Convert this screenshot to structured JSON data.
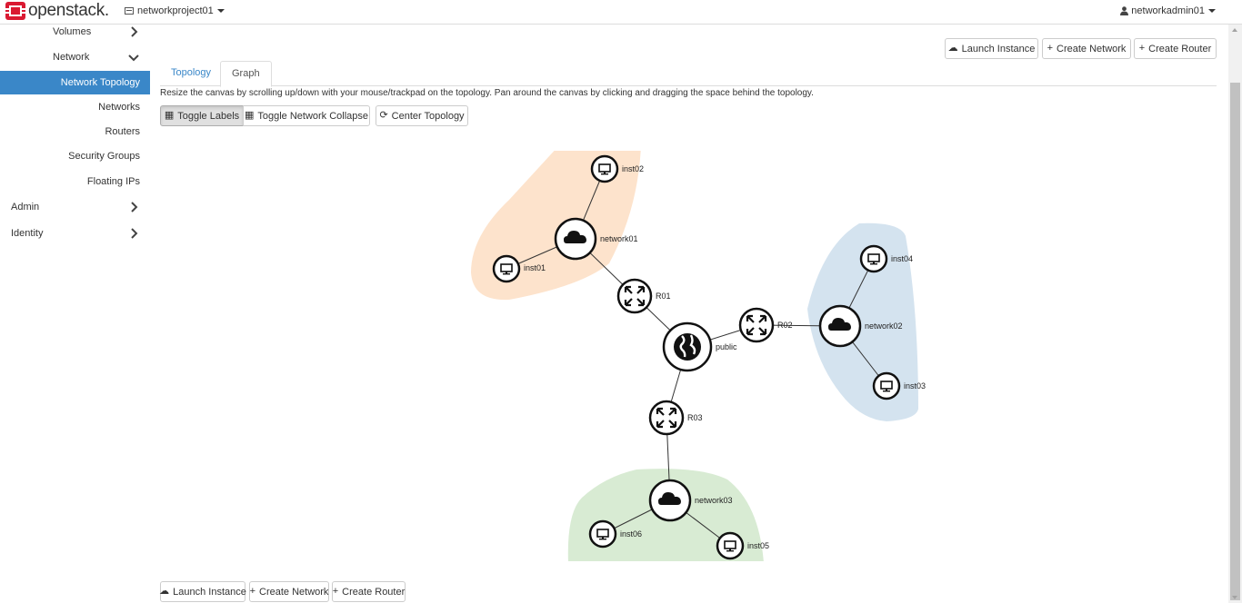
{
  "header": {
    "brand": "openstack.",
    "project": "networkproject01",
    "user": "networkadmin01"
  },
  "sidebar": {
    "items": [
      {
        "label": "Volumes"
      },
      {
        "label": "Network"
      },
      {
        "label": "Network Topology"
      },
      {
        "label": "Networks"
      },
      {
        "label": "Routers"
      },
      {
        "label": "Security Groups"
      },
      {
        "label": "Floating IPs"
      },
      {
        "label": "Admin"
      },
      {
        "label": "Identity"
      }
    ]
  },
  "actions_top": {
    "launch_instance": "Launch Instance",
    "create_network": "Create Network",
    "create_router": "Create Router"
  },
  "tabs": [
    {
      "label": "Topology"
    },
    {
      "label": "Graph"
    }
  ],
  "hint": "Resize the canvas by scrolling up/down with your mouse/trackpad on the topology. Pan around the canvas by clicking and dragging the space behind the topology.",
  "toolbar": {
    "toggle_labels": "Toggle Labels",
    "toggle_collapse": "Toggle Network Collapse",
    "center": "Center Topology"
  },
  "topology": {
    "external": {
      "label": "public"
    },
    "routers": [
      {
        "label": "R01"
      },
      {
        "label": "R02"
      },
      {
        "label": "R03"
      }
    ],
    "networks": [
      {
        "label": "network01",
        "color": "#fde3cc"
      },
      {
        "label": "network02",
        "color": "#d4e3ef"
      },
      {
        "label": "network03",
        "color": "#d8ebd3"
      }
    ],
    "instances": [
      {
        "label": "inst01"
      },
      {
        "label": "inst02"
      },
      {
        "label": "inst03"
      },
      {
        "label": "inst04"
      },
      {
        "label": "inst05"
      },
      {
        "label": "inst06"
      }
    ]
  },
  "actions_bottom": {
    "launch_instance": "Launch Instance",
    "create_network": "Create Network",
    "create_router": "Create Router"
  },
  "colors": {
    "accent": "#3a87c8",
    "brand": "#da1a32"
  }
}
